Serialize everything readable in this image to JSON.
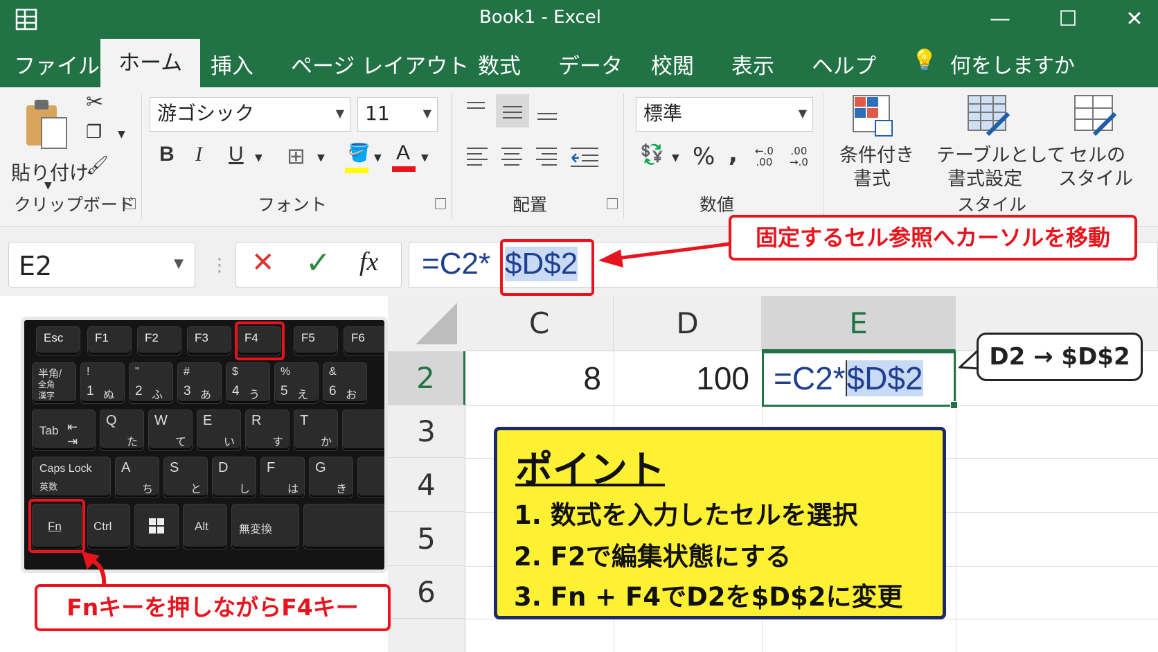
{
  "window": {
    "title": "Book1  -  Excel",
    "minimize": "—",
    "maximize": "☐",
    "close": "✕"
  },
  "menu": {
    "tabs": [
      "ファイル",
      "ホーム",
      "挿入",
      "ページ レイアウト",
      "数式",
      "データ",
      "校閲",
      "表示",
      "ヘルプ"
    ],
    "active": "ホーム",
    "search_placeholder": "何をしますか"
  },
  "ribbon": {
    "clipboard": {
      "paste_label": "貼り付け",
      "group_label": "クリップボード"
    },
    "font": {
      "font_name": "游ゴシック",
      "font_size": "11",
      "bold": "B",
      "italic": "I",
      "underline": "U",
      "group_label": "フォント"
    },
    "alignment": {
      "group_label": "配置"
    },
    "number": {
      "format": "標準",
      "percent": "%",
      "comma": ",",
      "group_label": "数値"
    },
    "styles": {
      "conditional_line1": "条件付き",
      "conditional_line2": "書式",
      "table_line1": "テーブルとして",
      "table_line2": "書式設定",
      "cell_line1": "セルの",
      "cell_line2": "スタイル",
      "group_label": "スタイル"
    }
  },
  "formula_bar": {
    "name_box": "E2",
    "cancel": "✕",
    "enter": "✓",
    "fx": "fx",
    "formula_prefix": "=C2*",
    "formula_highlight": "$D$2"
  },
  "sheet": {
    "columns": [
      "C",
      "D",
      "E"
    ],
    "rows": [
      "2",
      "3",
      "4",
      "5",
      "6"
    ],
    "C2": "8",
    "D2": "100",
    "E2_prefix": "=C2*",
    "E2_highlight": "$D$2"
  },
  "keyboard": {
    "fn_row": [
      "Esc",
      "F1",
      "F2",
      "F3",
      "F4",
      "F5",
      "F6"
    ],
    "num_row": [
      {
        "top": "半角/",
        "mid": "全角",
        "bot": "漢字"
      },
      {
        "top": "!",
        "bot": "1",
        "kana": "ぬ"
      },
      {
        "top": "\"",
        "bot": "2",
        "kana": "ふ"
      },
      {
        "top": "#",
        "bot": "3",
        "kana": "あ"
      },
      {
        "top": "$",
        "bot": "4",
        "kana": "う"
      },
      {
        "top": "%",
        "bot": "5",
        "kana": "え"
      },
      {
        "top": "&",
        "bot": "6",
        "kana": "お"
      }
    ],
    "tab": "Tab",
    "qwerty": [
      {
        "k": "Q",
        "kana": "た"
      },
      {
        "k": "W",
        "kana": "て"
      },
      {
        "k": "E",
        "kana": "い"
      },
      {
        "k": "R",
        "kana": "す"
      },
      {
        "k": "T",
        "kana": "か"
      }
    ],
    "caps": "Caps Lock",
    "caps_sub": "英数",
    "asdf": [
      {
        "k": "A",
        "kana": "ち"
      },
      {
        "k": "S",
        "kana": "と"
      },
      {
        "k": "D",
        "kana": "し"
      },
      {
        "k": "F",
        "kana": "は"
      },
      {
        "k": "G",
        "kana": "き"
      }
    ],
    "fn": "Fn",
    "ctrl": "Ctrl",
    "alt": "Alt",
    "muhenkan": "無変換"
  },
  "annotations": {
    "move_cursor": "固定するセル参照へカーソルを移動",
    "fn_f4": "Fnキーを押しながらF4キー",
    "d2_change": "D2 → $D$2",
    "point_title": "ポイント",
    "point_items": [
      "1. 数式を入力したセルを選択",
      "2. F2で編集状態にする",
      "3. Fn + F4でD2を$D$2に変更"
    ]
  },
  "colors": {
    "excel_green": "#217346",
    "highlight_red": "#e8141d",
    "point_yellow": "#fef133",
    "point_border": "#1a2a6c",
    "formula_blue": "#1f3f8f"
  }
}
